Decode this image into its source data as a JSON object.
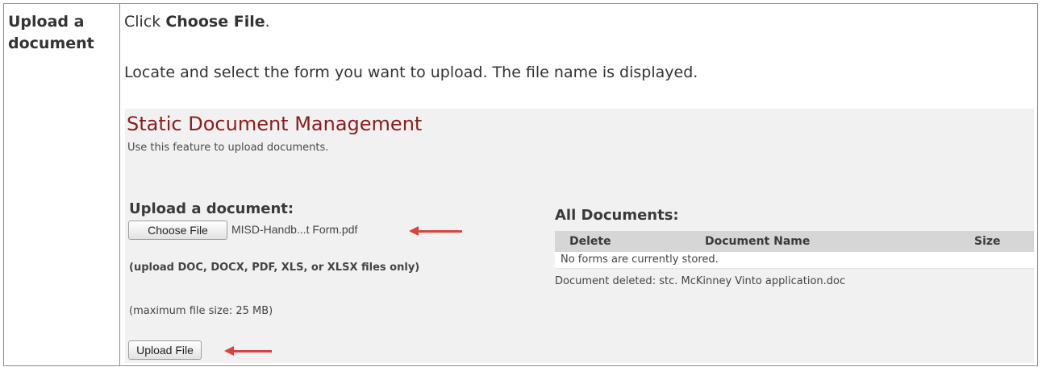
{
  "step": {
    "label_line1": "Upload a",
    "label_line2": "document"
  },
  "instructions": {
    "line1_prefix": "Click ",
    "line1_bold": "Choose File",
    "line1_suffix": ".",
    "line2": "Locate and select the form you want to upload. The file name is displayed."
  },
  "screenshot": {
    "title": "Static Document Management",
    "subtitle": "Use this feature to upload documents.",
    "upload": {
      "heading": "Upload a document:",
      "choose_file_label": "Choose File",
      "file_name": "MISD-Handb...t Form.pdf",
      "types_note": "(upload DOC, DOCX, PDF, XLS, or XLSX files only)",
      "size_note": "(maximum file size: 25 MB)",
      "upload_button_label": "Upload File"
    },
    "all_documents": {
      "heading": "All Documents:",
      "columns": [
        "Delete",
        "Document Name",
        "Size"
      ],
      "empty_message": "No forms are currently stored.",
      "status_message": "Document deleted: stc. McKinney Vinto application.doc"
    },
    "colors": {
      "title": "#8c1c1c",
      "arrow": "#e0403a",
      "panel_bg": "#f1f1f1",
      "table_header_bg": "#d6d6d6"
    }
  }
}
